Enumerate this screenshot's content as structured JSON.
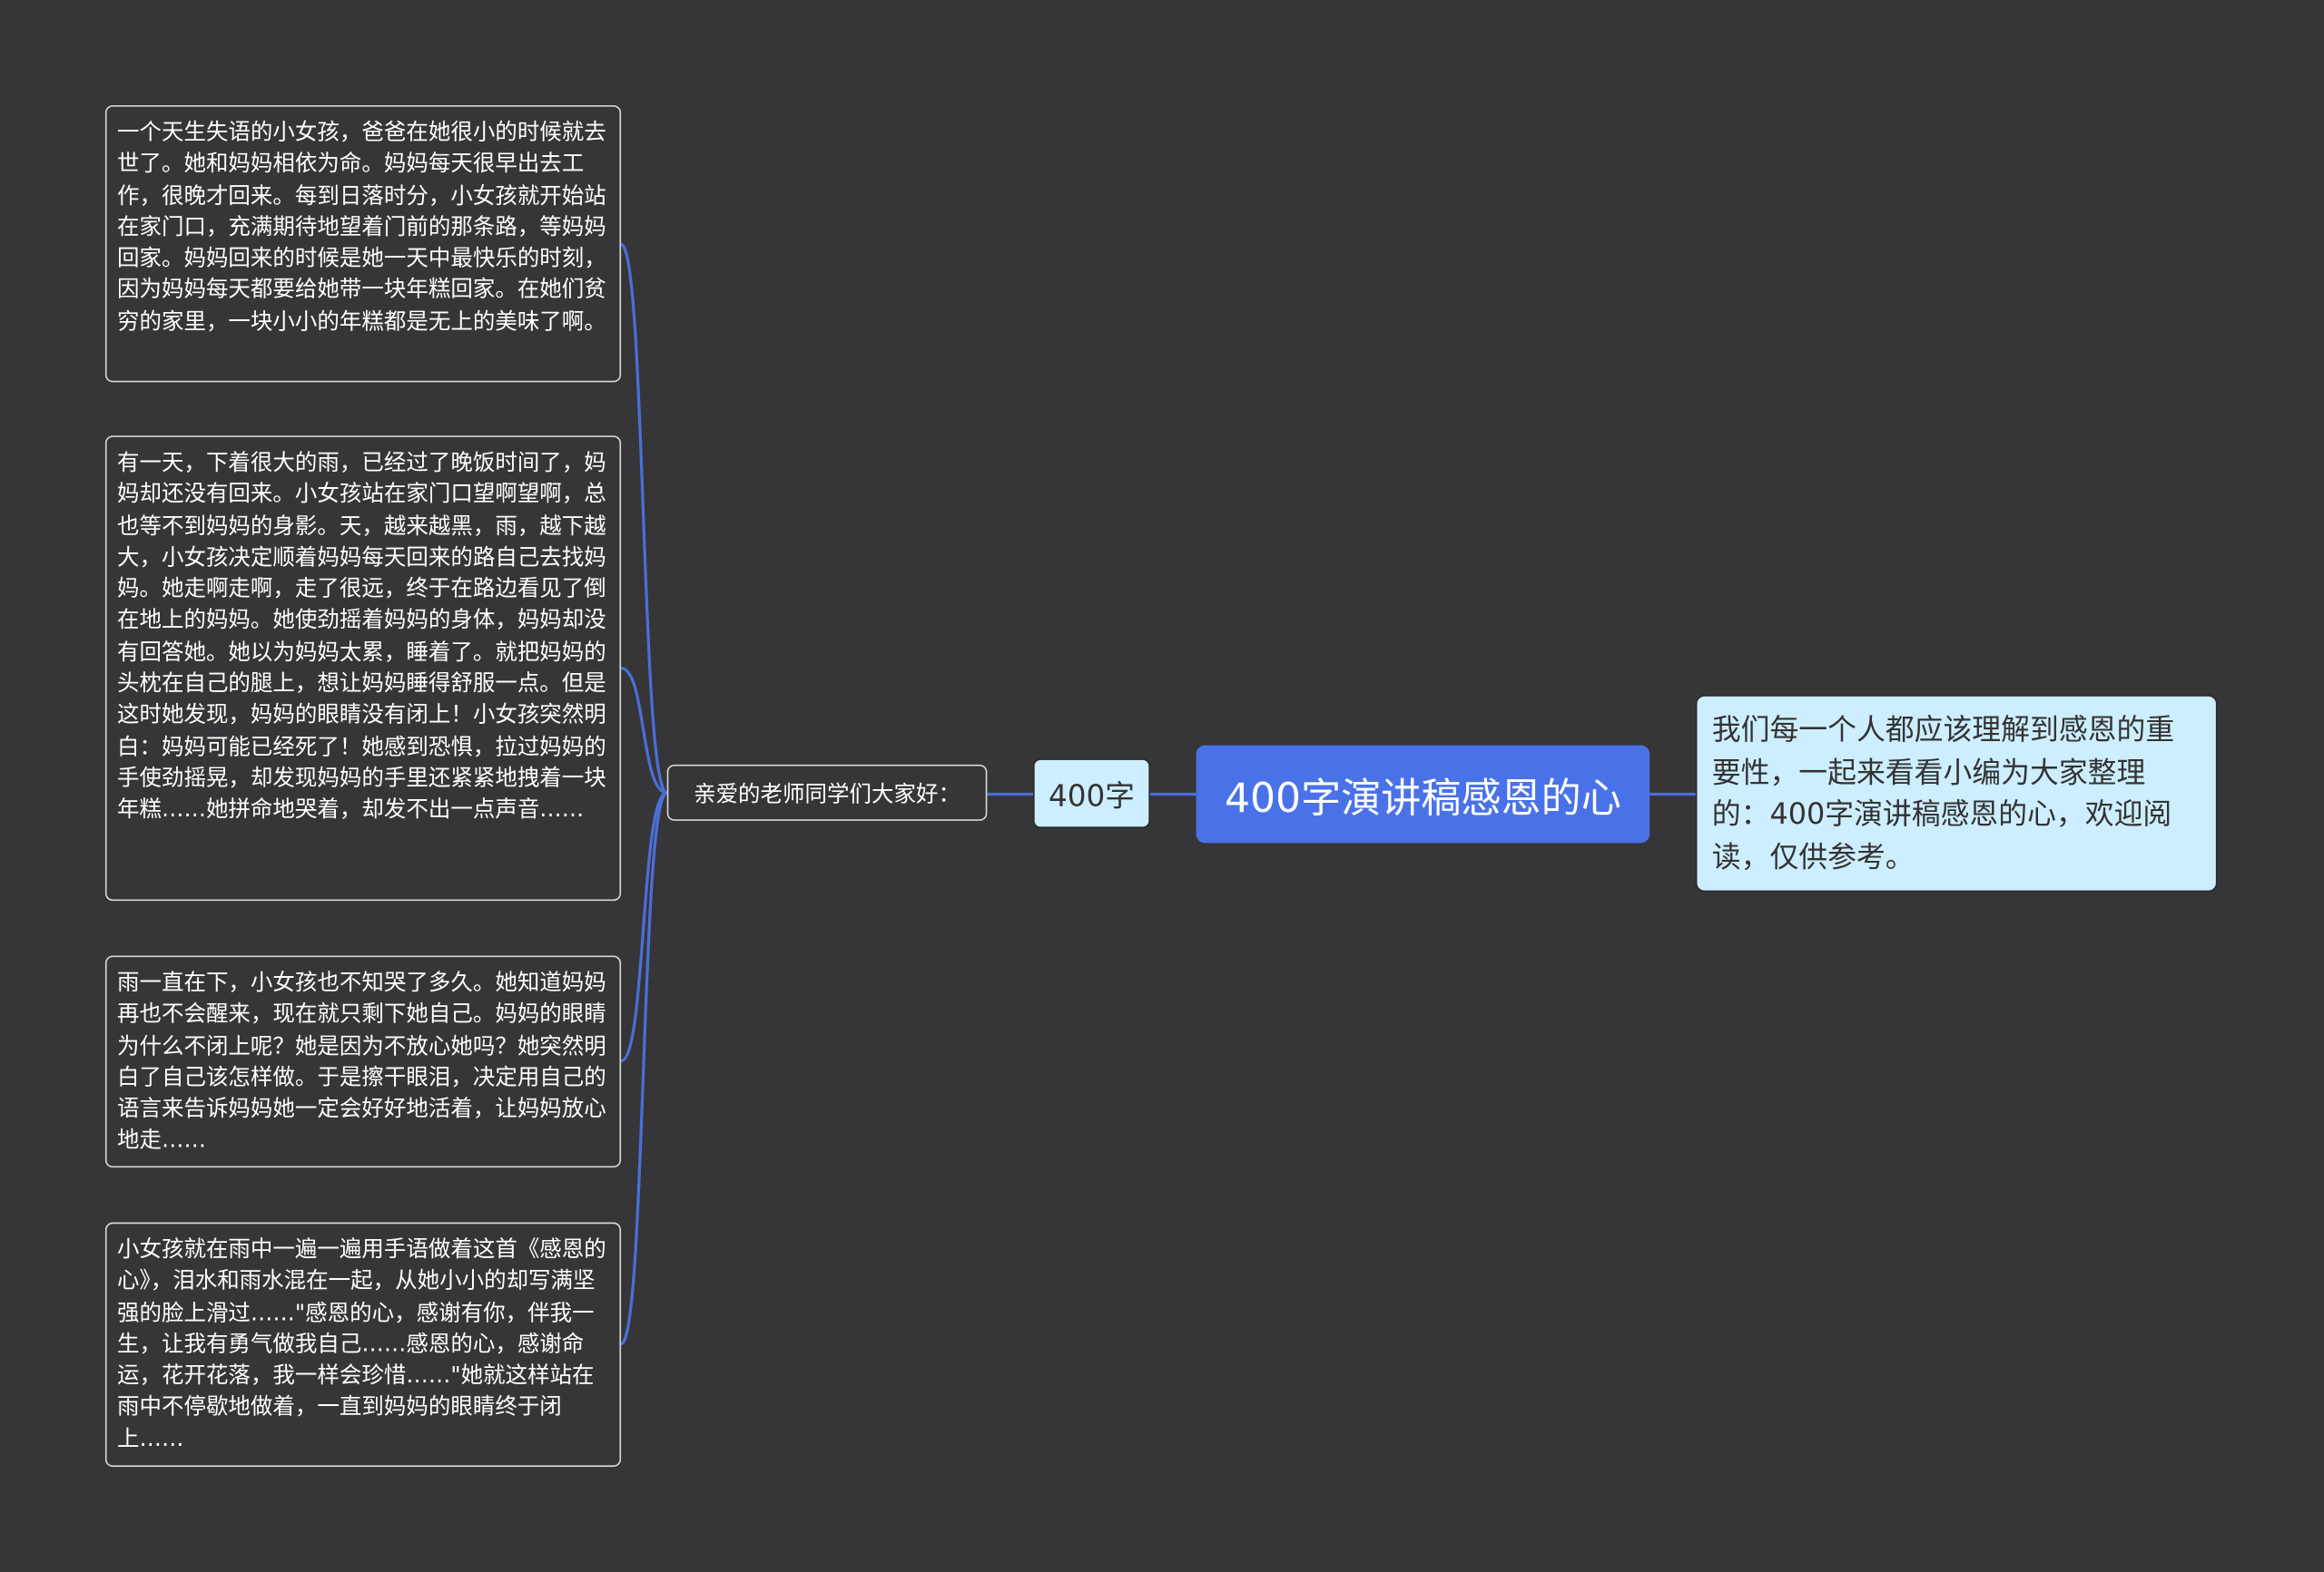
{
  "root": {
    "label": "400字演讲稿感恩的心"
  },
  "summary": {
    "text": "我们每一个人都应该理解到感恩的重要性，一起来看看小编为大家整理的：400字演讲稿感恩的心，欢迎阅读，仅供参考。"
  },
  "branch": {
    "label": "400字"
  },
  "sub": {
    "label": "亲爱的老师同学们大家好："
  },
  "leaves": [
    {
      "text": "一个天生失语的小女孩，爸爸在她很小的时候就去世了。她和妈妈相依为命。妈妈每天很早出去工作，很晚才回来。每到日落时分，小女孩就开始站在家门口，充满期待地望着门前的那条路，等妈妈回家。妈妈回来的时候是她一天中最快乐的时刻，因为妈妈每天都要给她带一块年糕回家。在她们贫穷的家里，一块小小的年糕都是无上的美味了啊。"
    },
    {
      "text": "有一天，下着很大的雨，已经过了晚饭时间了，妈妈却还没有回来。小女孩站在家门口望啊望啊，总也等不到妈妈的身影。天，越来越黑，雨，越下越大，小女孩决定顺着妈妈每天回来的路自己去找妈妈。她走啊走啊，走了很远，终于在路边看见了倒在地上的妈妈。她使劲摇着妈妈的身体，妈妈却没有回答她。她以为妈妈太累，睡着了。就把妈妈的头枕在自己的腿上，想让妈妈睡得舒服一点。但是这时她发现，妈妈的眼睛没有闭上！小女孩突然明白：妈妈可能已经死了！她感到恐惧，拉过妈妈的手使劲摇晃，却发现妈妈的手里还紧紧地拽着一块年糕……她拼命地哭着，却发不出一点声音……"
    },
    {
      "text": "雨一直在下，小女孩也不知哭了多久。她知道妈妈再也不会醒来，现在就只剩下她自己。妈妈的眼睛为什么不闭上呢？她是因为不放心她吗？她突然明白了自己该怎样做。于是擦干眼泪，决定用自己的语言来告诉妈妈她一定会好好地活着，让妈妈放心地走……"
    },
    {
      "text": "小女孩就在雨中一遍一遍用手语做着这首《感恩的心》，泪水和雨水混在一起，从她小小的却写满坚强的脸上滑过……\"感恩的心，感谢有你，伴我一生，让我有勇气做我自己……感恩的心，感谢命运，花开花落，我一样会珍惜……\"她就这样站在雨中不停歇地做着，一直到妈妈的眼睛终于闭上……"
    }
  ],
  "colors": {
    "background": "#363538",
    "root_fill": "#4a72e8",
    "light_fill": "#cdeefe",
    "link": "#4a6fd8"
  }
}
